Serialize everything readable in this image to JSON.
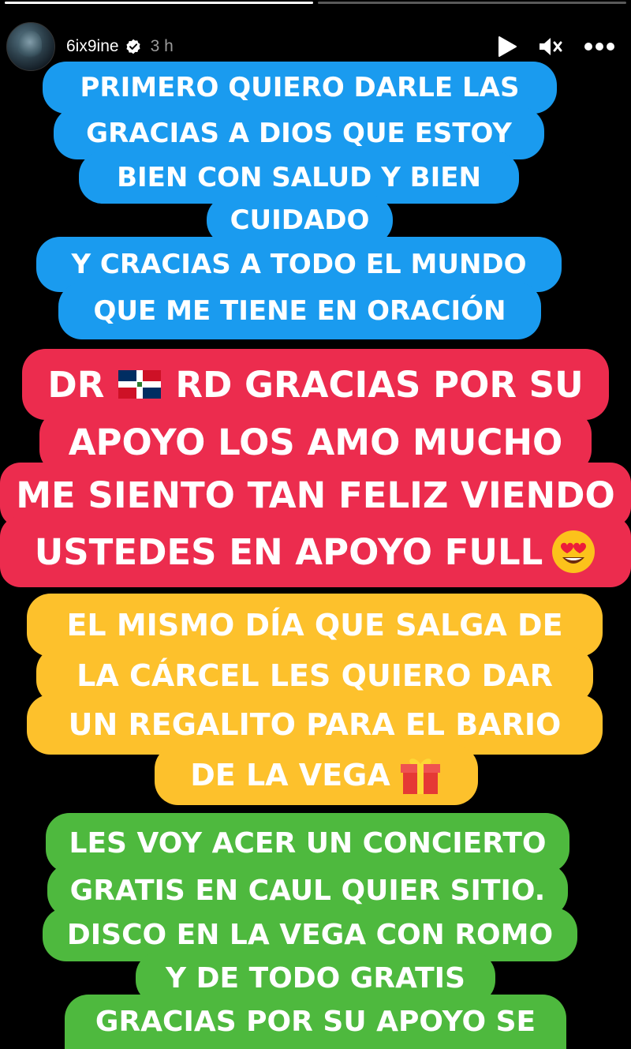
{
  "progress": [
    {
      "name": "segment-1",
      "fill": 1.0
    },
    {
      "name": "segment-2",
      "fill": 0.0
    },
    {
      "name": "segment-3",
      "fill": 0.0
    },
    {
      "name": "segment-4",
      "fill": 0.0
    }
  ],
  "header": {
    "username": "6ix9ine",
    "time": "3 h",
    "avatar_icon": "avatar-photo",
    "verified_icon": "verified-badge-icon",
    "play_icon": "play-icon",
    "mute_icon": "muted-speaker-icon",
    "more_icon": "more-horizontal-icon"
  },
  "colors": {
    "blue": "#1a9bef",
    "red": "#ec2c4e",
    "yellow": "#fdc12c",
    "green": "#4eb93e"
  },
  "story": {
    "blue_lines": [
      "PRIMERO QUIERO DARLE LAS",
      "GRACIAS A DIOS QUE ESTOY",
      "BIEN CON SALUD Y BIEN",
      "CUIDADO",
      "Y CRACIAS A TODO EL MUNDO",
      "QUE ME TIENE EN ORACIÓN"
    ],
    "red_lines": [
      "DR",
      "RD GRACIAS POR SU",
      "APOYO LOS AMO MUCHO",
      "ME SIENTO TAN FELIZ VIENDO",
      "USTEDES EN APOYO FULL"
    ],
    "red_flag_icon": "dominican-flag-icon",
    "red_emoji_icon": "heart-eyes-emoji-icon",
    "yellow_lines": [
      "EL MISMO DÍA QUE SALGA DE",
      "LA CÁRCEL LES QUIERO DAR",
      "UN REGALITO PARA EL BARIO",
      "DE LA VEGA"
    ],
    "yellow_emoji_icon": "gift-emoji-icon",
    "green_lines": [
      "LES VOY ACER UN CONCIERTO",
      "GRATIS EN CAUL QUIER SITIO.",
      "DISCO EN LA VEGA CON ROMO",
      "Y DE TODO GRATIS",
      "GRACIAS POR SU APOYO SE"
    ]
  }
}
